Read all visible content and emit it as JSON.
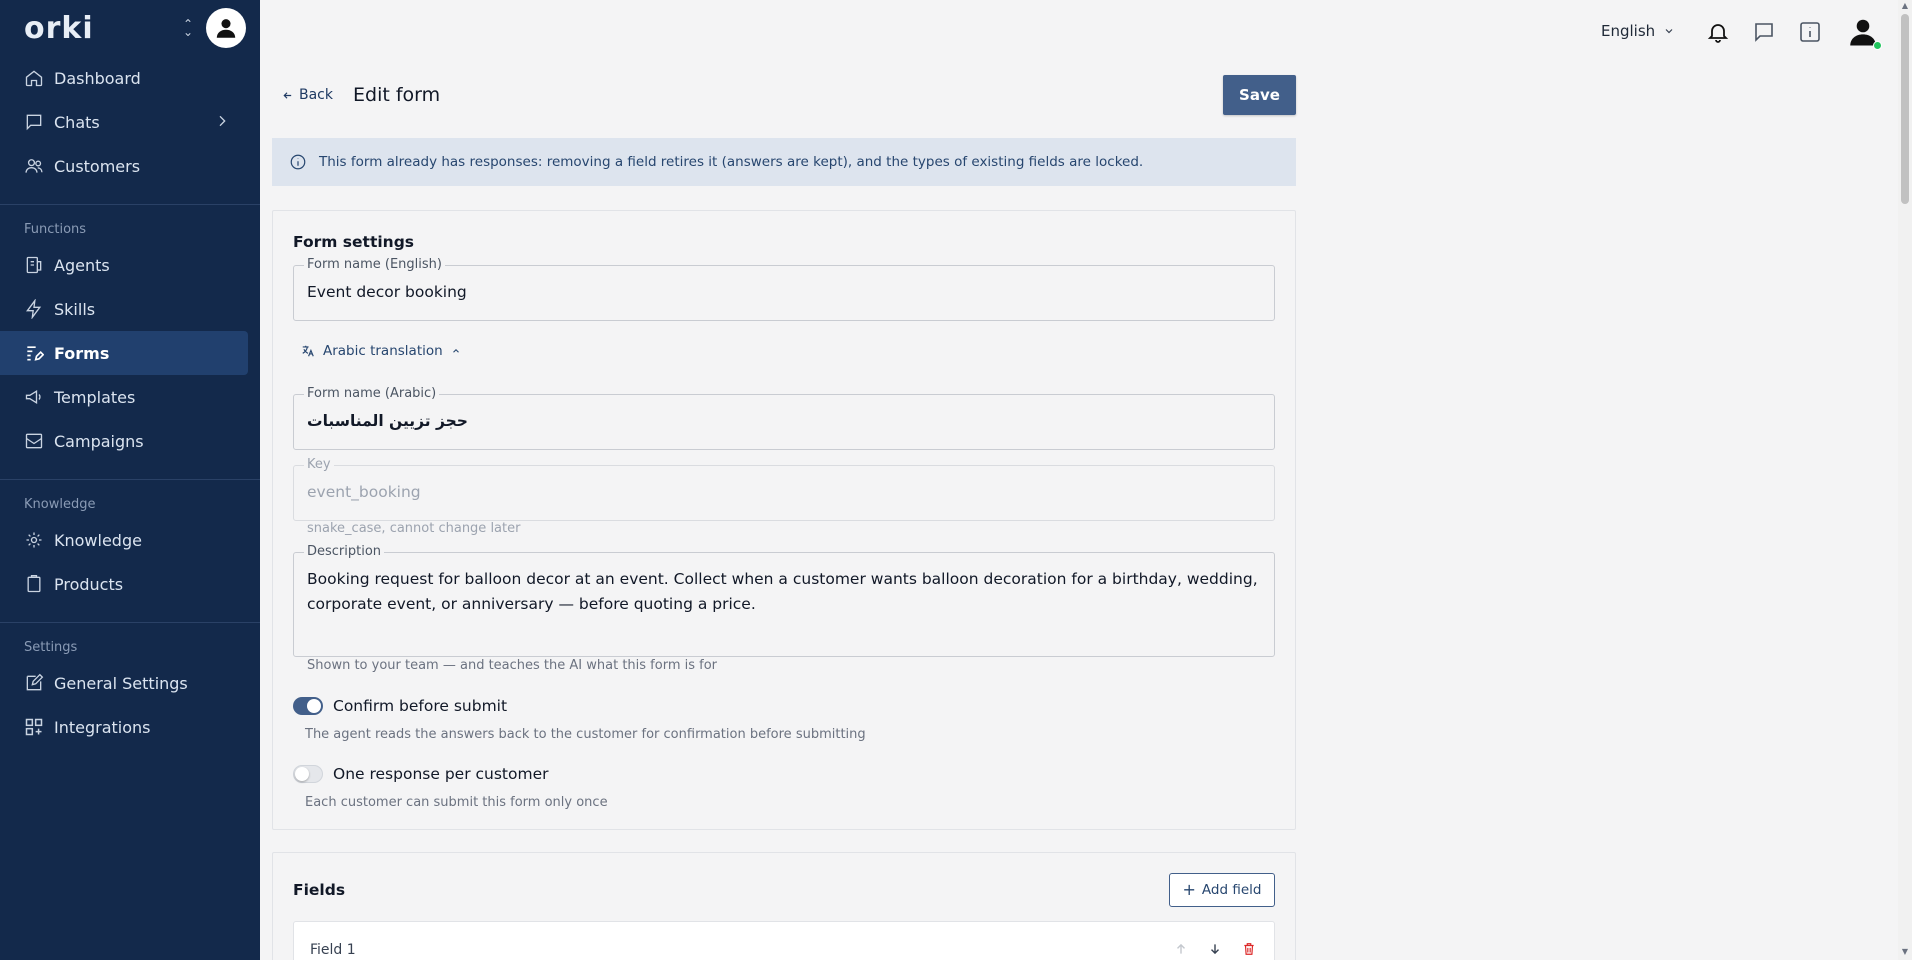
{
  "brand": {
    "logo_text": "orki"
  },
  "sidebar": {
    "items": [
      {
        "label": "Dashboard",
        "icon": "home-icon"
      },
      {
        "label": "Chats",
        "icon": "chat-icon"
      },
      {
        "label": "Customers",
        "icon": "users-icon"
      }
    ],
    "functions_label": "Functions",
    "functions": [
      {
        "label": "Agents",
        "icon": "agent-icon"
      },
      {
        "label": "Skills",
        "icon": "lightning-icon"
      },
      {
        "label": "Forms",
        "icon": "form-icon",
        "active": true
      },
      {
        "label": "Templates",
        "icon": "megaphone-icon"
      },
      {
        "label": "Campaigns",
        "icon": "mail-icon"
      }
    ],
    "knowledge_label": "Knowledge",
    "knowledge": [
      {
        "label": "Knowledge",
        "icon": "brain-icon"
      },
      {
        "label": "Products",
        "icon": "clipboard-icon"
      }
    ],
    "settings_label": "Settings",
    "settings": [
      {
        "label": "General Settings",
        "icon": "edit-icon"
      },
      {
        "label": "Integrations",
        "icon": "grid-icon"
      }
    ]
  },
  "topbar": {
    "language": "English",
    "icons": [
      "bell-icon",
      "chat-bubble-icon",
      "info-icon",
      "user-icon"
    ]
  },
  "header": {
    "back_label": "Back",
    "title": "Edit form",
    "save_label": "Save"
  },
  "banner": {
    "text": "This form already has responses: removing a field retires it (answers are kept), and the types of existing fields are locked."
  },
  "settings": {
    "title": "Form settings",
    "name_en": {
      "label": "Form name (English)",
      "value": "Event decor booking"
    },
    "translation_toggle": "Arabic translation",
    "name_ar": {
      "label": "Form name (Arabic)",
      "value": "حجز تزيين المناسبات"
    },
    "key": {
      "label": "Key",
      "value": "event_booking",
      "helper": "snake_case, cannot change later"
    },
    "description": {
      "label": "Description",
      "value": "Booking request for balloon decor at an event. Collect when a customer wants balloon decoration for a birthday, wedding, corporate event, or anniversary — before quoting a price.",
      "helper": "Shown to your team — and teaches the AI what this form is for"
    },
    "confirm": {
      "label": "Confirm before submit",
      "on": true,
      "helper": "The agent reads the answers back to the customer for confirmation before submitting"
    },
    "one_response": {
      "label": "One response per customer",
      "on": false,
      "helper": "Each customer can submit this form only once"
    }
  },
  "fields": {
    "title": "Fields",
    "add_label": "Add field",
    "items": [
      {
        "label": "Field 1"
      }
    ]
  },
  "colors": {
    "sidebar": "#13294b",
    "accent": "#425f8a",
    "banner": "#dde4ee",
    "danger": "#dc2626"
  }
}
